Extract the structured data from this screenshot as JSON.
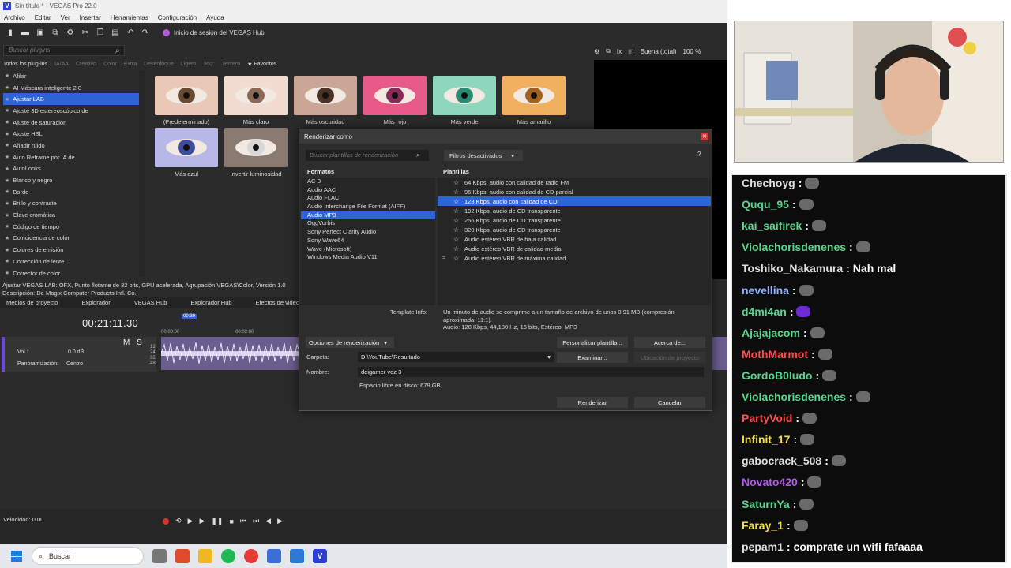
{
  "app": {
    "title": "Sin título * - VEGAS Pro 22.0",
    "logo_letter": "V",
    "menu": [
      "Archivo",
      "Editar",
      "Ver",
      "Insertar",
      "Herramientas",
      "Configuración",
      "Ayuda"
    ],
    "hub_label": "Inicio de sesión del VEGAS Hub"
  },
  "plugins": {
    "search_placeholder": "Buscar plugins",
    "tabs": [
      "Todos los plug-ins",
      "IA/AA",
      "Creativo",
      "Color",
      "Extra",
      "Desenfoque",
      "Ligero",
      "360°",
      "Tercero",
      "Favoritos"
    ],
    "items": [
      "Afilar",
      "AI Máscara inteligente 2.0",
      "Ajustar LAB",
      "Ajuste 3D estereoscópico de",
      "Ajuste de saturación",
      "Ajuste HSL",
      "Añadir ruido",
      "Auto Reframe por IA de",
      "AutoLooks",
      "Blanco y negro",
      "Borde",
      "Brillo y contraste",
      "Clave cromática",
      "Código de tiempo",
      "Coincidencia de color",
      "Colores de emisión",
      "Corrección de lente",
      "Corrector de color"
    ],
    "selected_index": 2,
    "presets": [
      {
        "label": "(Predeterminado)",
        "iris": "#6b4a32",
        "tint": "#e9c8b8"
      },
      {
        "label": "Más claro",
        "iris": "#8a6a55",
        "tint": "#f2dcd2"
      },
      {
        "label": "Más oscuridad",
        "iris": "#4a3225",
        "tint": "#c9a696"
      },
      {
        "label": "Más rojo",
        "iris": "#8a2a5a",
        "tint": "#e85a8a"
      },
      {
        "label": "Más verde",
        "iris": "#2c8a72",
        "tint": "#8fd6bf"
      },
      {
        "label": "Más amarillo",
        "iris": "#a0621e",
        "tint": "#f0b060"
      },
      {
        "label": "Más azul",
        "iris": "#3e4e9a",
        "tint": "#b8b8e8"
      },
      {
        "label": "Invertir luminosidad",
        "iris": "#d8d8d8",
        "tint": "#8a7a70"
      }
    ],
    "status_line1": "Ajustar VEGAS LAB: OFX, Punto flotante de 32 bits, GPU acelerada, Agrupación VEGAS\\Color, Versión 1.0",
    "status_line2": "Descripción: De Magix Computer Products Intl. Co."
  },
  "window_tabs": [
    "Medios de proyecto",
    "Explorador",
    "VEGAS Hub",
    "Explorador Hub",
    "Efectos de video"
  ],
  "preview": {
    "quality": "Buena (total)",
    "zoom": "100 %"
  },
  "timeline": {
    "timecode": "00:21:11.30",
    "ruler": [
      "00:00:00",
      "00:02:00"
    ],
    "marker": "00:39",
    "track_m": "M",
    "track_s": "S",
    "vol_label": "Vol.:",
    "vol_value": "0.0 dB",
    "pan_label": "Panoramización:",
    "pan_value": "Centro",
    "speed": "Velocidad: 0.00",
    "db_scale": [
      "12",
      "24",
      "36",
      "48"
    ]
  },
  "dialog": {
    "title": "Renderizar como",
    "search_placeholder": "Buscar plantillas de renderización",
    "filter": "Filtros desactivados",
    "help": "?",
    "formats_title": "Formatos",
    "formats": [
      "AC-3",
      "Audio AAC",
      "Audio FLAC",
      "Audio Interchange File Format (AIFF)",
      "Audio MP3",
      "OggVorbis",
      "Sony Perfect Clarity Audio",
      "Sony Wave64",
      "Wave (Microsoft)",
      "Windows Media Audio V11"
    ],
    "format_selected": 4,
    "templates_title": "Plantillas",
    "templates": [
      "64 Kbps, audio con calidad de radio FM",
      "96 Kbps, audio con calidad de CD parcial",
      "128 Kbps, audio con calidad de CD",
      "192 Kbps, audio de CD transparente",
      "256 Kbps, audio de CD transparente",
      "320 Kbps, audio de CD transparente",
      "Audio estéreo VBR de baja calidad",
      "Audio estéreo VBR de calidad media",
      "Audio estéreo VBR de máxima calidad"
    ],
    "template_selected": 2,
    "template_info_label": "Template Info:",
    "template_info": "Un minuto de audio se comprime a un tamaño de archivo de unos 0.91 MB (compresión aproximada: 11:1).",
    "template_info2": "Audio: 128 Kbps, 44,100 Hz, 16 bits, Estéreo, MP3",
    "render_options": "Opciones de renderización",
    "customize": "Personalizar plantilla...",
    "about": "Acerca de...",
    "folder_label": "Carpeta:",
    "folder_value": "D:\\YouTube\\Resultado",
    "browse": "Examinar...",
    "project_location": "Ubicación de proyecto",
    "name_label": "Nombre:",
    "name_value": "deigamer voz 3",
    "free_space": "Espacio libre en disco: 679 GB",
    "render": "Renderizar",
    "cancel": "Cancelar"
  },
  "chat": [
    {
      "user": "Chechoyg",
      "color": "#e0e0e0",
      "text": ""
    },
    {
      "user": "Ququ_95",
      "color": "#58d68d",
      "text": ""
    },
    {
      "user": "kai_saifirek",
      "color": "#58d68d",
      "text": ""
    },
    {
      "user": "Violachorisdenenes",
      "color": "#58d68d",
      "text": ""
    },
    {
      "user": "Toshiko_Nakamura",
      "color": "#e0e0e0",
      "text": "Nah mal"
    },
    {
      "user": "nevellina",
      "color": "#8fb4ff",
      "text": ""
    },
    {
      "user": "d4mi4an",
      "color": "#58d68d",
      "text": ""
    },
    {
      "user": "Ajajajacom",
      "color": "#58d68d",
      "text": ""
    },
    {
      "user": "MothMarmot",
      "color": "#ff4d4d",
      "text": ""
    },
    {
      "user": "GordoB0ludo",
      "color": "#58d68d",
      "text": ""
    },
    {
      "user": "Violachorisdenenes",
      "color": "#58d68d",
      "text": ""
    },
    {
      "user": "PartyVoid",
      "color": "#ff4d4d",
      "text": ""
    },
    {
      "user": "Infinit_17",
      "color": "#f0e040",
      "text": ""
    },
    {
      "user": "gabocrack_508",
      "color": "#e0e0e0",
      "text": ""
    },
    {
      "user": "Novato420",
      "color": "#b45af0",
      "text": ""
    },
    {
      "user": "SaturnYa",
      "color": "#58d68d",
      "text": ""
    },
    {
      "user": "Faray_1",
      "color": "#f0e040",
      "text": ""
    },
    {
      "user": "pepam1",
      "color": "#e0e0e0",
      "text": "comprate un wifi fafaaaa"
    }
  ],
  "taskbar": {
    "search": "Buscar"
  }
}
